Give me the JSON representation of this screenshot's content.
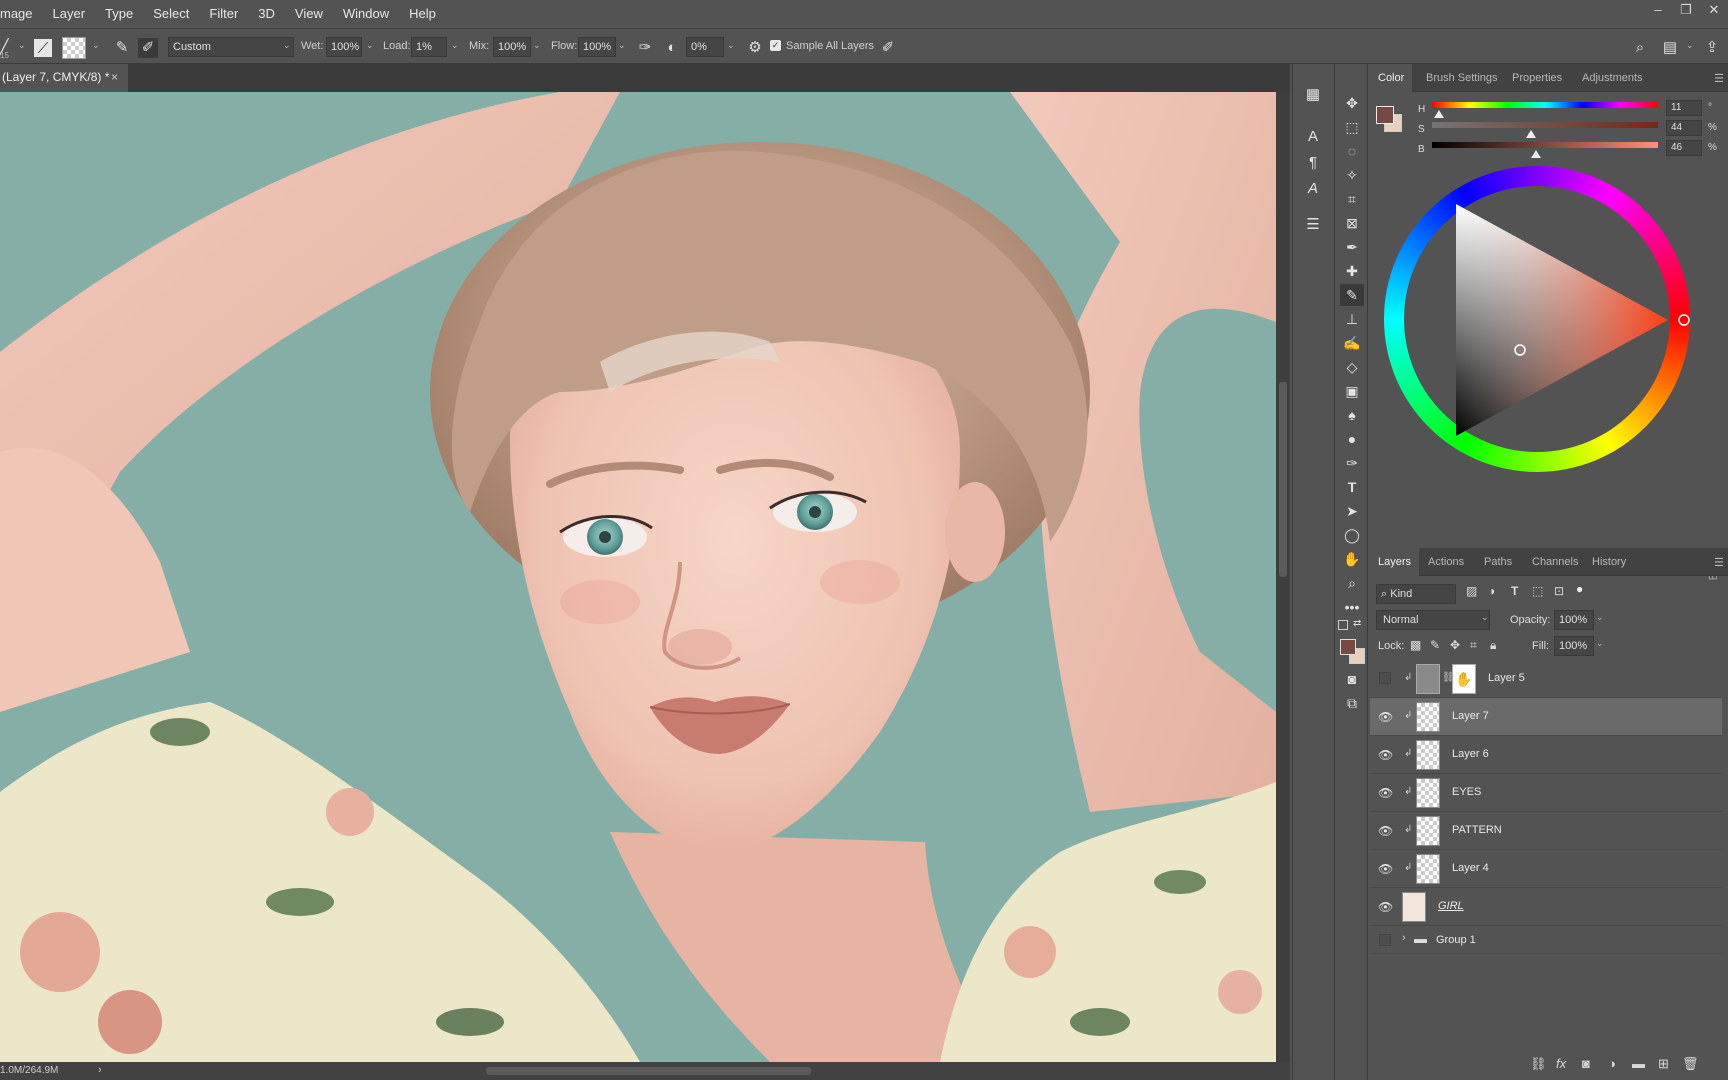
{
  "menu": [
    "mage",
    "Layer",
    "Type",
    "Select",
    "Filter",
    "3D",
    "View",
    "Window",
    "Help"
  ],
  "window_controls": [
    "–",
    "❐",
    "✕"
  ],
  "options": {
    "brush_preset": "Custom",
    "wet_label": "Wet:",
    "wet_value": "100%",
    "load_label": "Load:",
    "load_value": "1%",
    "mix_label": "Mix:",
    "mix_value": "100%",
    "flow_label": "Flow:",
    "flow_value": "100%",
    "angle_value": "0%",
    "sample_all_label": "Sample All Layers",
    "small_label": "15"
  },
  "document": {
    "tab_title": "(Layer 7, CMYK/8) *",
    "close": "×",
    "status_text": "1.0M/264.9M",
    "status_arrow": "›"
  },
  "color_panel": {
    "tabs": [
      "Color",
      "Brush Settings",
      "Properties",
      "Adjustments"
    ],
    "h_label": "H",
    "h_value": "11",
    "h_unit": "°",
    "s_label": "S",
    "s_value": "44",
    "s_unit": "%",
    "b_label": "B",
    "b_value": "46",
    "b_unit": "%",
    "foreground_color": "#754a42",
    "background_color": "#e8d2bf",
    "h_fraction": 0.03,
    "s_fraction": 0.44,
    "b_fraction": 0.46
  },
  "layers_panel": {
    "tabs": [
      "Layers",
      "Actions",
      "Paths",
      "Channels",
      "History"
    ],
    "filter_kind": "Kind",
    "blend_mode": "Normal",
    "opacity_label": "Opacity:",
    "opacity_value": "100%",
    "lock_label": "Lock:",
    "fill_label": "Fill:",
    "fill_value": "100%",
    "layers": [
      {
        "name": "Layer 5",
        "visible": false,
        "clipped": true,
        "mask": true,
        "selected": false
      },
      {
        "name": "Layer 7",
        "visible": true,
        "clipped": true,
        "mask": false,
        "selected": true
      },
      {
        "name": "Layer 6",
        "visible": true,
        "clipped": true,
        "mask": false,
        "selected": false
      },
      {
        "name": "EYES",
        "visible": true,
        "clipped": true,
        "mask": false,
        "selected": false
      },
      {
        "name": "PATTERN",
        "visible": true,
        "clipped": true,
        "mask": false,
        "selected": false
      },
      {
        "name": "Layer 4",
        "visible": true,
        "clipped": true,
        "mask": false,
        "selected": false
      },
      {
        "name": "GIRL",
        "visible": true,
        "clipped": false,
        "mask": false,
        "selected": false
      },
      {
        "name": "Group 1",
        "visible": false,
        "clipped": false,
        "mask": false,
        "selected": false,
        "group": true
      }
    ],
    "footer_icons": [
      "link-icon",
      "fx-icon",
      "mask-icon",
      "adjustment-icon",
      "folder-icon",
      "new-layer-icon",
      "trash-icon"
    ]
  },
  "colors": {
    "canvas_bg": "#84aea6",
    "skin": "#efc7b6",
    "hair": "#b8957f",
    "dress": "#ede7c9"
  }
}
